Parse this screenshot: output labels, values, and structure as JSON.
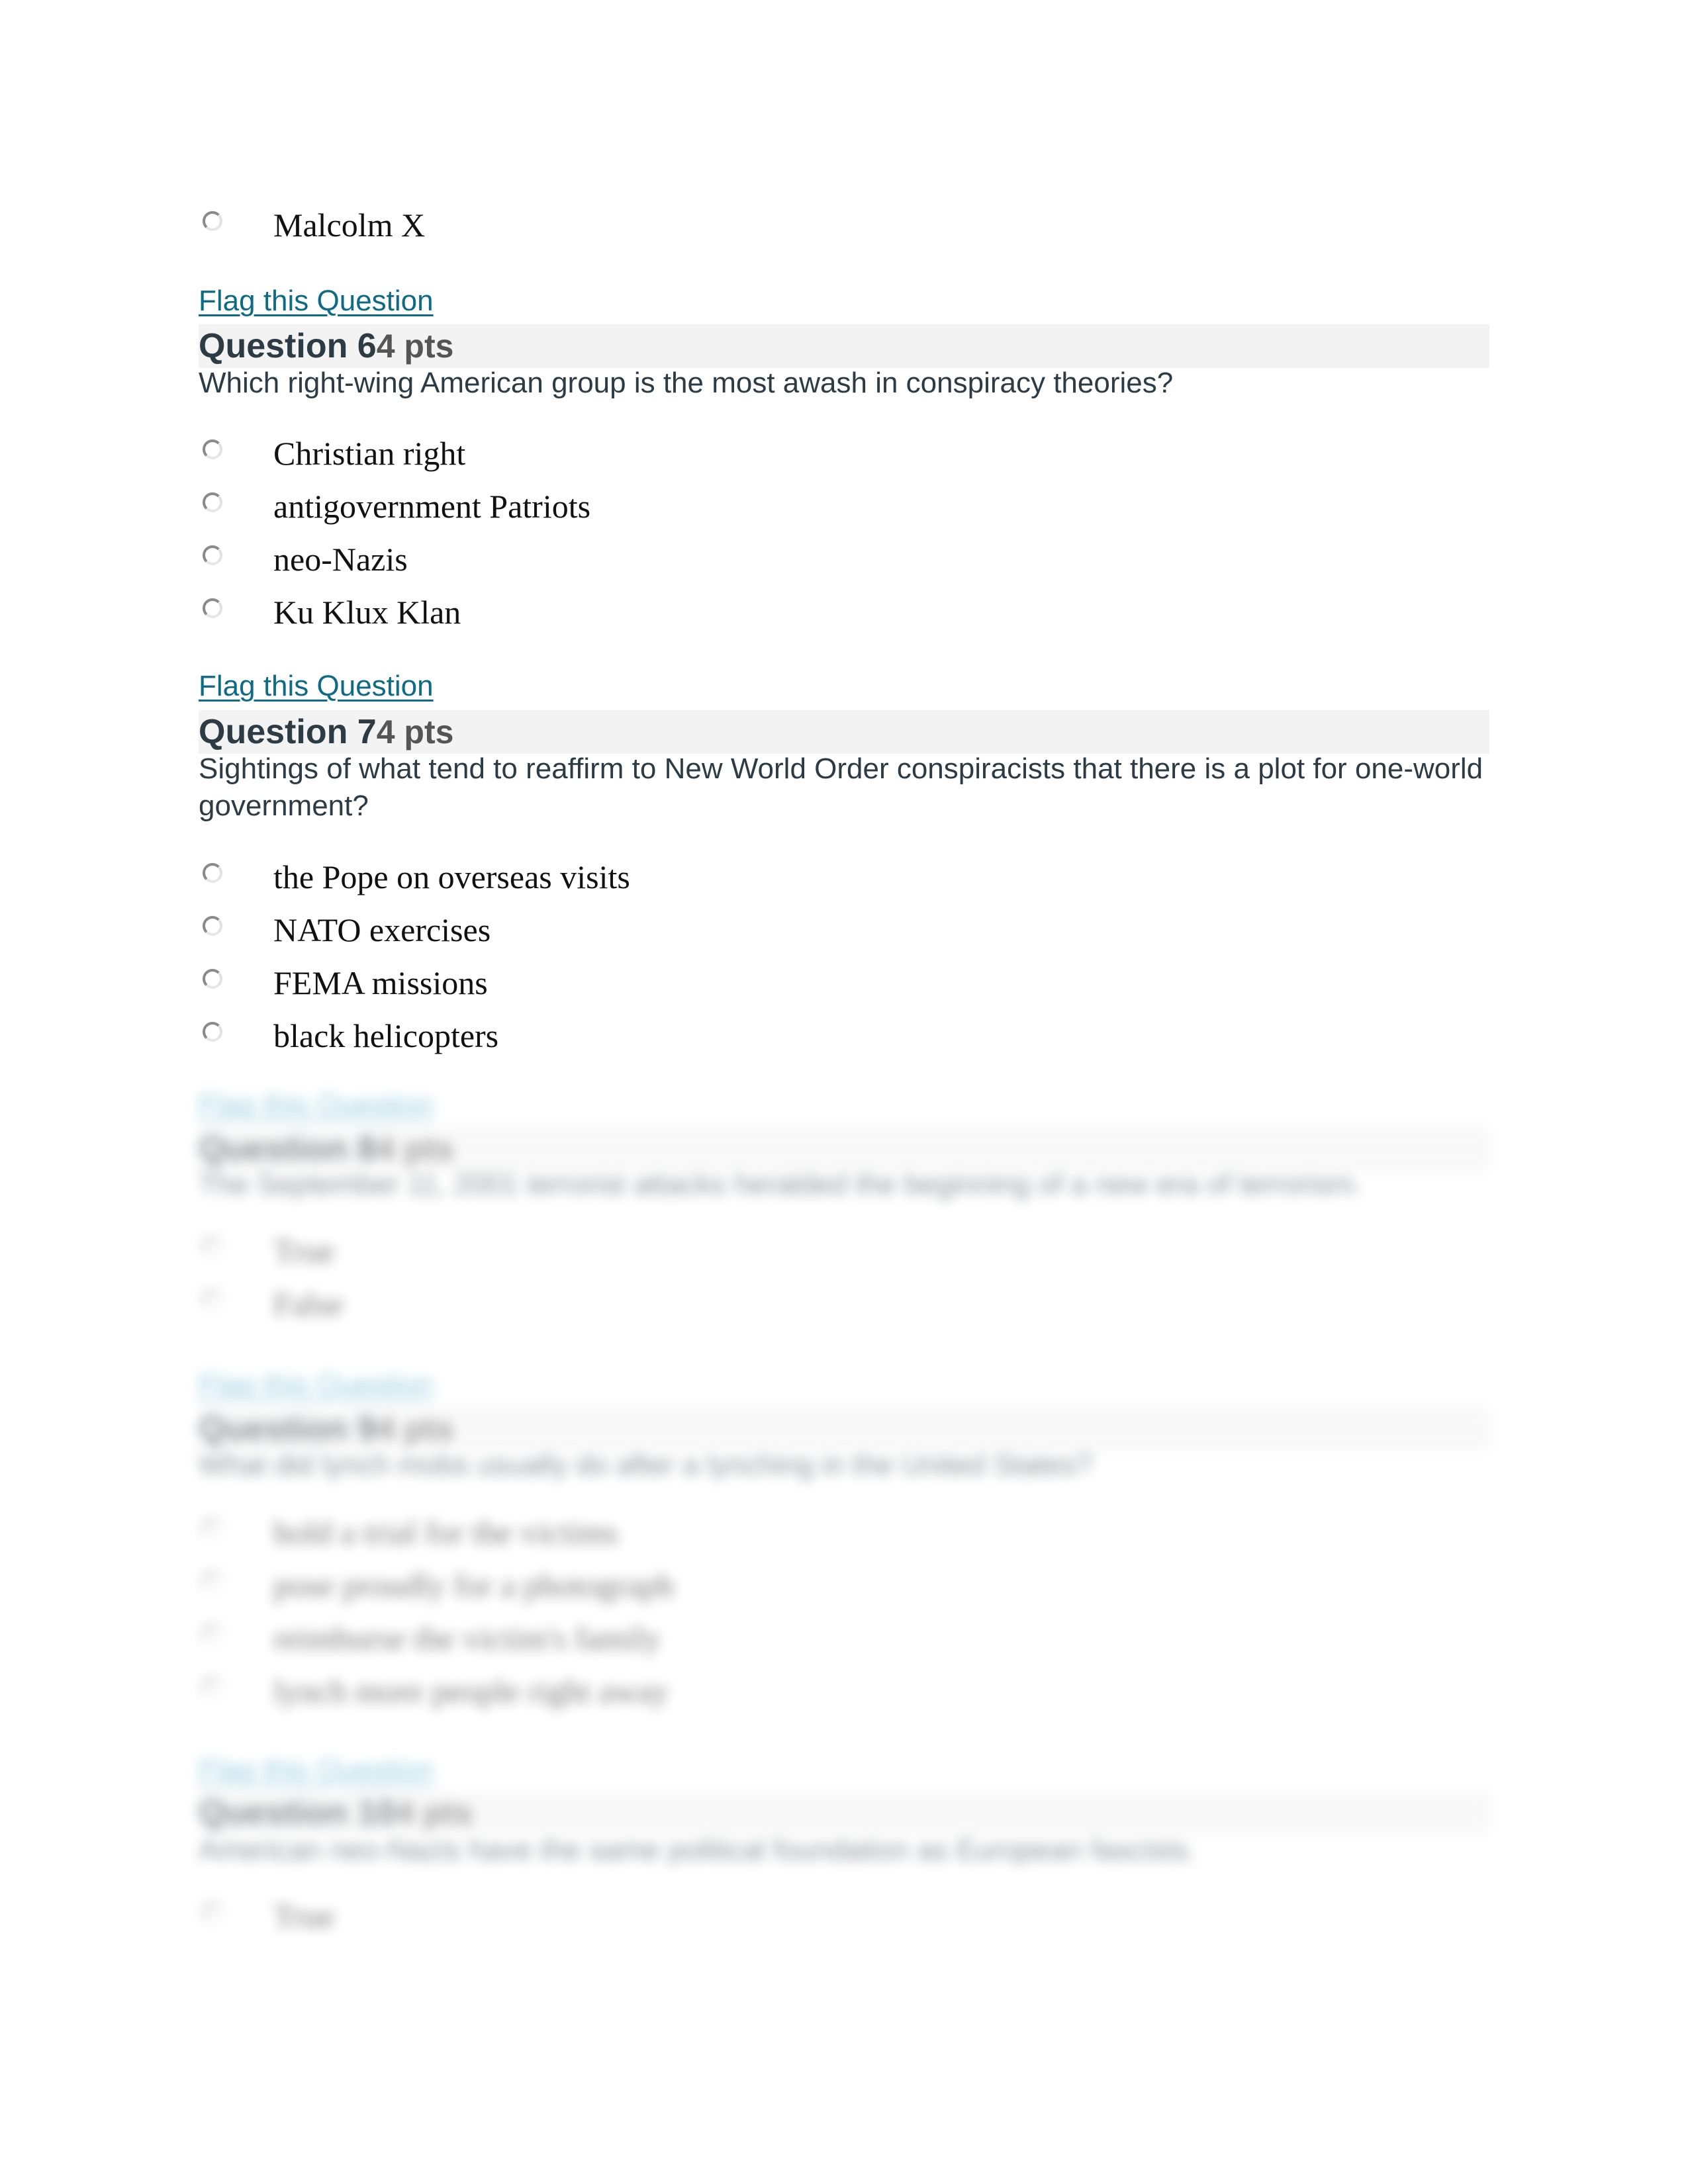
{
  "flag_label": "Flag this Question",
  "prev_question_tail": {
    "options": [
      "Malcolm X"
    ]
  },
  "questions": [
    {
      "title": "Question 6",
      "points": "4 pts",
      "text": "Which right-wing American group is the most awash in conspiracy theories?",
      "options": [
        "Christian right",
        "antigovernment Patriots",
        "neo-Nazis",
        "Ku Klux Klan"
      ]
    },
    {
      "title": "Question 7",
      "points": "4 pts",
      "text": "Sightings of what tend to reaffirm to New World Order conspiracists that there is a plot for one-world government?",
      "options": [
        "the Pope on overseas visits",
        "NATO exercises",
        "FEMA missions",
        "black helicopters"
      ]
    },
    {
      "title": "Question 8",
      "points": "4 pts",
      "text": "The September 11, 2001 terrorist attacks heralded the beginning of a new era of terrorism.",
      "options": [
        "True",
        "False"
      ],
      "blurred": true
    },
    {
      "title": "Question 9",
      "points": "4 pts",
      "text": "What did lynch mobs usually do after a lynching in the United States?",
      "options": [
        "hold a trial for the victims",
        "pose proudly for a photograph",
        "reimburse the victim's family",
        "lynch more people right away"
      ],
      "blurred": true
    },
    {
      "title": "Question 10",
      "points": "4 pts",
      "text": "American neo-Nazis have the same political foundation as European fascists.",
      "options": [
        "True"
      ],
      "blurred": true
    }
  ]
}
